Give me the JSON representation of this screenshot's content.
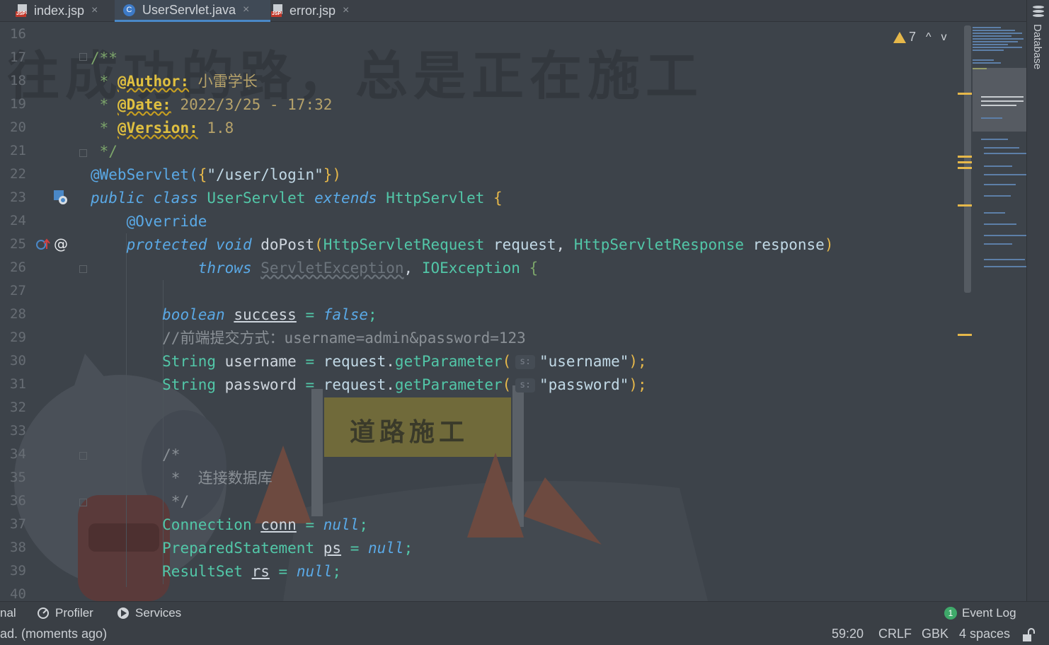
{
  "tabs": [
    {
      "label": "index.jsp",
      "icon": "jsp-file-icon",
      "active": false
    },
    {
      "label": "UserServlet.java",
      "icon": "java-class-icon",
      "active": true
    },
    {
      "label": "error.jsp",
      "icon": "jsp-file-icon",
      "active": false
    }
  ],
  "tab_close": "×",
  "file_badges": {
    "jsp": "JSP",
    "java": "C"
  },
  "right_sidebar": {
    "label": "Database"
  },
  "inspections": {
    "count": "7",
    "up": "^",
    "down": "v"
  },
  "gutter": {
    "line_numbers": [
      "16",
      "17",
      "18",
      "19",
      "20",
      "21",
      "22",
      "23",
      "24",
      "25",
      "26",
      "27",
      "28",
      "29",
      "30",
      "31",
      "32",
      "33",
      "34",
      "35",
      "36",
      "37",
      "38",
      "39",
      "40"
    ],
    "override_marker": "@"
  },
  "code": {
    "l17": "/**",
    "l18_star": " * ",
    "l18_tag": "@Author:",
    "l18_val": " 小雷学长",
    "l19_star": " * ",
    "l19_tag": "@Date:",
    "l19_val": " 2022/3/25 - 17:32",
    "l20_star": " * ",
    "l20_tag": "@Version:",
    "l20_val": " 1.8",
    "l21": " */",
    "l22_ann": "@WebServlet(",
    "l22_br": "{",
    "l22_str": "\"/user/login\"",
    "l22_end": "})",
    "l23_kw1": "public",
    "l23_kw2": "class",
    "l23_name": "UserServlet",
    "l23_kw3": "extends",
    "l23_sup": "HttpServlet",
    "l23_br": "{",
    "l24": "@Override",
    "l25_kw1": "protected",
    "l25_kw2": "void",
    "l25_fn": "doPost",
    "l25_p1": "(",
    "l25_t1": "HttpServletRequest",
    "l25_v1": " request",
    "l25_c": ", ",
    "l25_t2": "HttpServletResponse",
    "l25_v2": " response",
    "l25_p2": ")",
    "l26_kw": "throws",
    "l26_e1": "ServletException",
    "l26_c": ", ",
    "l26_e2": "IOException",
    "l26_br": "{",
    "l28_kw": "boolean",
    "l28_v": "success",
    "l28_eq": " = ",
    "l28_val": "false",
    "l28_end": ";",
    "l29": "//前端提交方式：username=admin&password=123",
    "l30_t": "String",
    "l30_v": " username",
    "l30_eq": " = ",
    "l30_o": "request",
    "l30_dot": ".",
    "l30_fn": "getParameter",
    "l30_p": "(",
    "l30_hint": "s:",
    "l30_str": "\"username\"",
    "l30_end": ");",
    "l31_t": "String",
    "l31_v": " password",
    "l31_eq": " = ",
    "l31_o": "request",
    "l31_dot": ".",
    "l31_fn": "getParameter",
    "l31_p": "(",
    "l31_hint": "s:",
    "l31_str": "\"password\"",
    "l31_end": ");",
    "l34": "/*",
    "l35": " *  连接数据库",
    "l36": " */",
    "l37_t": "Connection",
    "l37_v": "conn",
    "l37_eq": " = ",
    "l37_val": "null",
    "l37_end": ";",
    "l38_t": "PreparedStatement",
    "l38_v": "ps",
    "l38_eq": " = ",
    "l38_val": "null",
    "l38_end": ";",
    "l39_t": "ResultSet",
    "l39_v": "rs",
    "l39_eq": " = ",
    "l39_val": "null",
    "l39_end": ";"
  },
  "wallpaper": {
    "slogan": "往成功的路，总是正在施工",
    "sign": "道路施工"
  },
  "tool_windows": [
    {
      "label": "nal",
      "icon": null
    },
    {
      "label": "Profiler",
      "icon": "profiler-icon"
    },
    {
      "label": "Services",
      "icon": "services-icon"
    }
  ],
  "event_log": {
    "label": "Event Log",
    "count": "1"
  },
  "status": {
    "message": "ad. (moments ago)",
    "position": "59:20",
    "line_sep": "CRLF",
    "encoding": "GBK",
    "indent": "4 spaces"
  },
  "colors": {
    "accent": "#4a88c7",
    "warning": "#e6b84a",
    "background": "#3d434a"
  }
}
